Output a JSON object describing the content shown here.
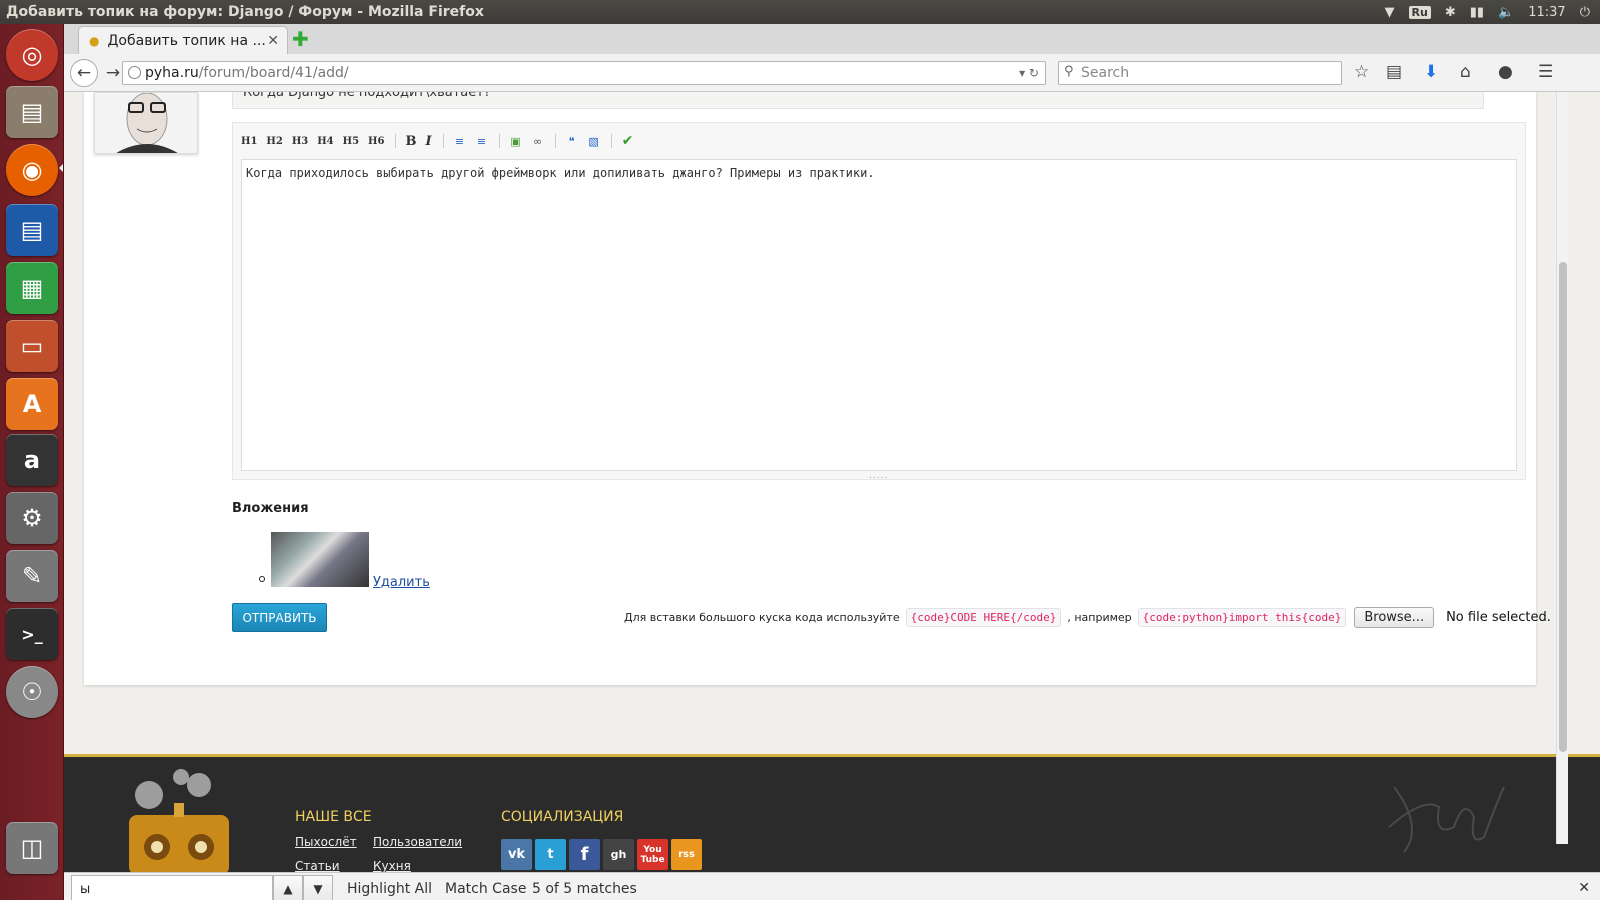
{
  "system": {
    "window_title": "Добавить топик на форум: Django / Форум - Mozilla Firefox",
    "keyboard_layout": "Ru",
    "clock": "11:37"
  },
  "launcher": {
    "items": [
      {
        "name": "ubuntu-dash-icon",
        "color": "#c0392b"
      },
      {
        "name": "files-icon",
        "color": "#8b7d6b"
      },
      {
        "name": "firefox-icon",
        "color": "#e66000"
      },
      {
        "name": "writer-icon",
        "color": "#1f5aa8"
      },
      {
        "name": "calc-icon",
        "color": "#2f9e44"
      },
      {
        "name": "impress-icon",
        "color": "#c0502b"
      },
      {
        "name": "software-center-icon",
        "color": "#e8731e"
      },
      {
        "name": "amazon-icon",
        "color": "#333333"
      },
      {
        "name": "system-settings-icon",
        "color": "#666666"
      },
      {
        "name": "text-editor-icon",
        "color": "#777777"
      },
      {
        "name": "terminal-icon",
        "color": "#2d2d2d"
      },
      {
        "name": "dvd-icon",
        "color": "#888888"
      },
      {
        "name": "trash-icon",
        "color": "#777777"
      }
    ]
  },
  "browser": {
    "tab_title": "Добавить топик на ...",
    "url_host": "pyha.ru",
    "url_path": "/forum/board/41/add/",
    "search_placeholder": "Search"
  },
  "page": {
    "topic_title": "Когда Django не подходит\\хватает?",
    "toolbar": [
      "H1",
      "H2",
      "H3",
      "H4",
      "H5",
      "H6"
    ],
    "bold": "B",
    "italic": "I",
    "body_text": "Когда приходилось выбирать другой фреймворк или допиливать джанго? Примеры из практики.",
    "attachments_heading": "Вложения",
    "delete_link": "Удалить",
    "submit_label": "ОТПРАВИТЬ",
    "hint_text": "Для вставки большого куска кода используйте",
    "hint_code1": "{code}CODE HERE{/code}",
    "hint_mid": ", например",
    "hint_code2": "{code:python}import this{code}",
    "browse_label": "Browse...",
    "no_file": "No file selected."
  },
  "footer": {
    "col1_heading": "НАШЕ ВСЕ",
    "col1_links": [
      "Пыхослёт",
      "Пользователи",
      "Статьи",
      "Кухня"
    ],
    "col2_heading": "СОЦИАЛИЗАЦИЯ",
    "social": [
      {
        "name": "vk-icon",
        "label": "vk",
        "color": "#4a76a8"
      },
      {
        "name": "twitter-icon",
        "label": "t",
        "color": "#2a9fd6"
      },
      {
        "name": "facebook-icon",
        "label": "f",
        "color": "#3b5998"
      },
      {
        "name": "github-icon",
        "label": "gh",
        "color": "#444444"
      },
      {
        "name": "youtube-icon",
        "label": "You Tube",
        "color": "#d9342b"
      },
      {
        "name": "rss-icon",
        "label": "rss",
        "color": "#e8961e"
      }
    ],
    "accent_color": "#d2b13e"
  },
  "findbar": {
    "query": "ы",
    "highlight_all": "Highlight All",
    "match_case": "Match Case",
    "matches": "5 of 5 matches"
  }
}
